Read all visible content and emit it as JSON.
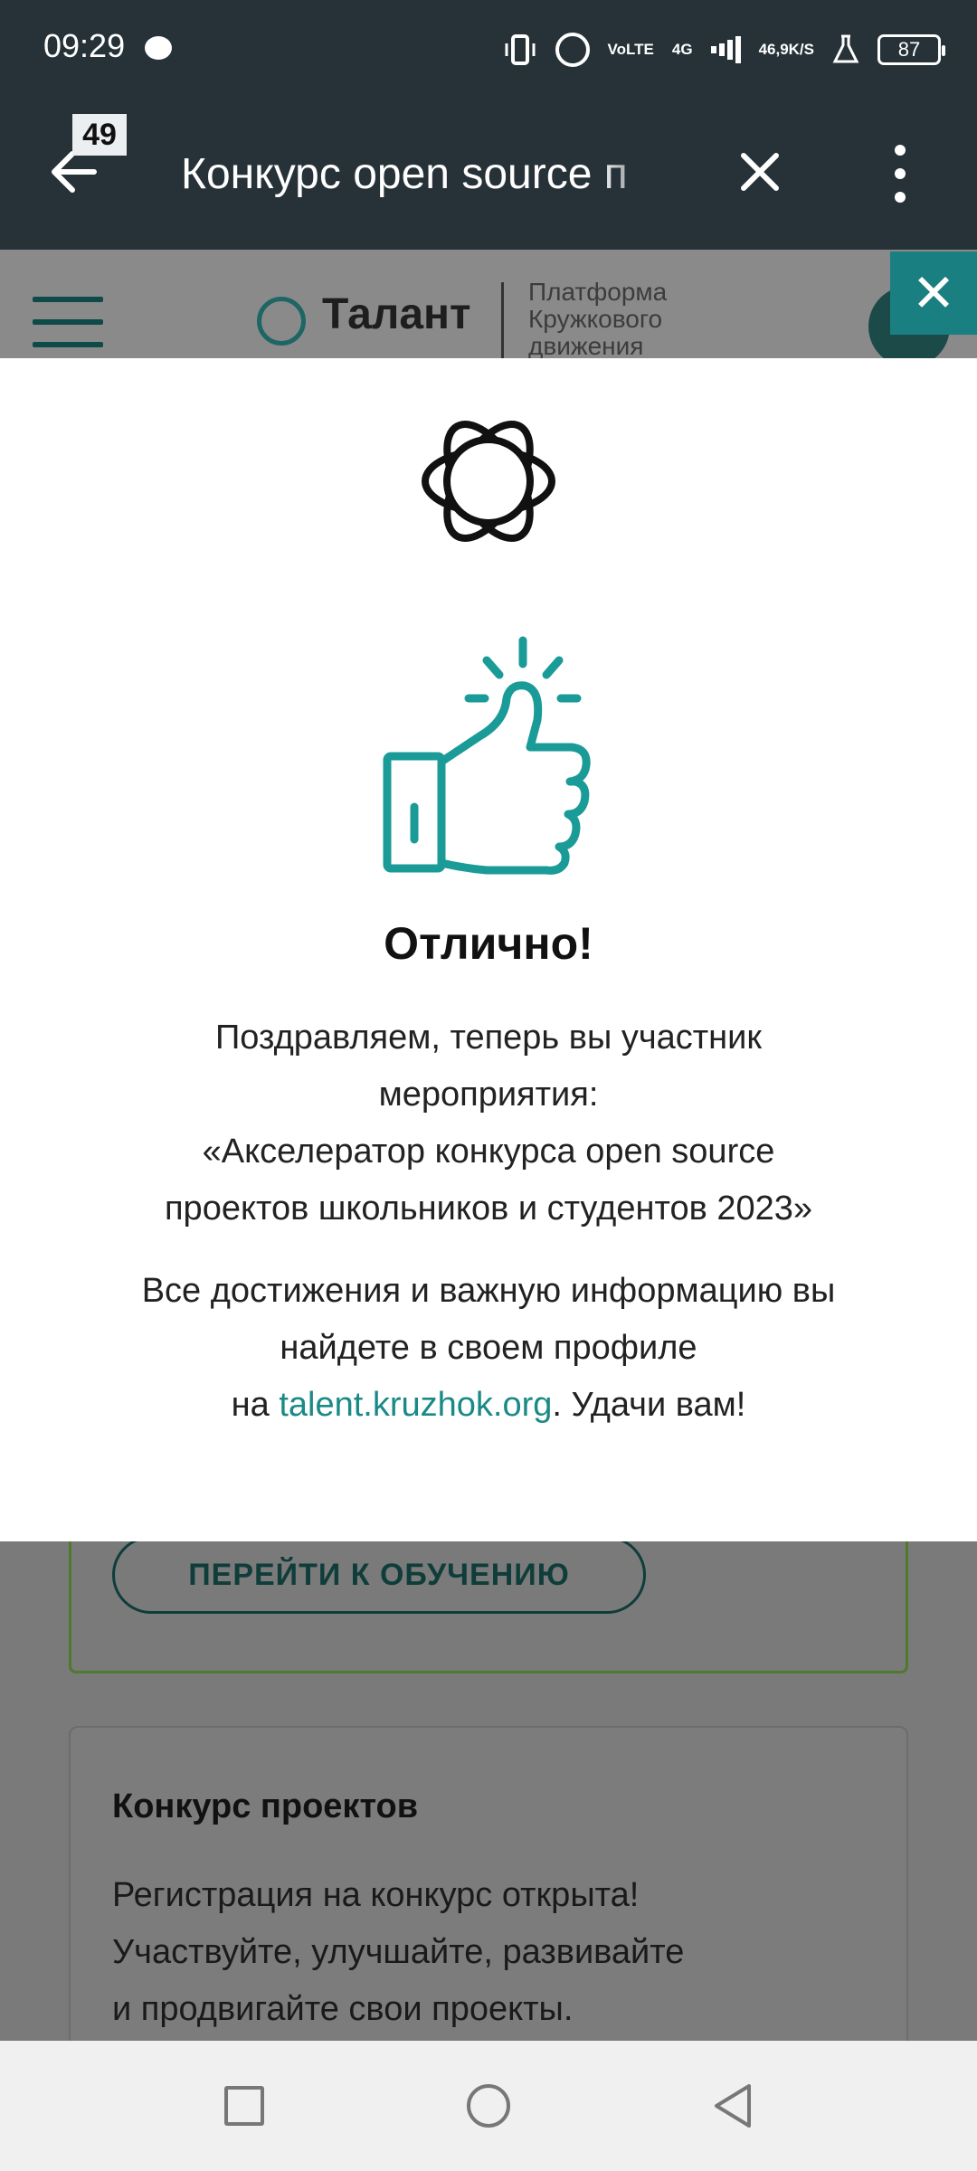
{
  "status_bar": {
    "time": "09:29",
    "network_label_top": "Vo",
    "network_label_bottom": "LTE",
    "network_type": "4G",
    "speed_value": "46,9",
    "speed_unit": "K/S",
    "battery": "87"
  },
  "browser": {
    "tab_count": "49",
    "url_text": "Конкурс open source п"
  },
  "site": {
    "brand": "Талант",
    "subtitle_lines": [
      "Платформа",
      "Кружкового",
      "движения"
    ],
    "learn_button": "ПЕРЕЙТИ К ОБУЧЕНИЮ",
    "contest_card": {
      "title": "Конкурс проектов",
      "text_lines": [
        "Регистрация на конкурс открыта!",
        "Участвуйте, улучшайте, развивайте",
        "и продвигайте свои проекты."
      ]
    }
  },
  "modal": {
    "title": "Отлично!",
    "message_lines": [
      "Поздравляем, теперь вы участник",
      "мероприятия:",
      "«Акселератор конкурса open source",
      "проектов школьников и студентов 2023»"
    ],
    "info_lines": [
      "Все достижения и важную информацию вы",
      "найдете в своем профиле"
    ],
    "info_prefix": "на ",
    "info_link": "talent.kruzhok.org",
    "info_suffix": ". Удачи вам!",
    "accent_color": "#1a9b97"
  },
  "colors": {
    "status_bg": "#263238",
    "modal_accent": "#1a9b97",
    "close_button_bg": "#1a7f80"
  }
}
